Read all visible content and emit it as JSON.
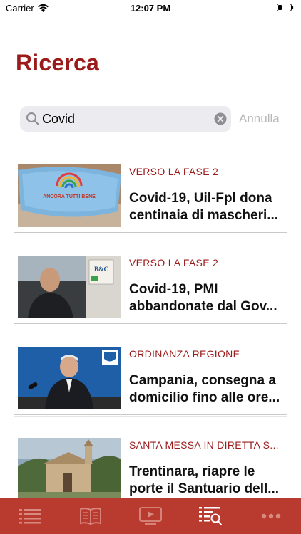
{
  "status_bar": {
    "carrier": "Carrier",
    "time": "12:07 PM"
  },
  "page": {
    "title": "Ricerca"
  },
  "search": {
    "value": "Covid",
    "cancel_label": "Annulla"
  },
  "articles": [
    {
      "category": "VERSO LA FASE 2",
      "title": "Covid-19, Uil-Fpl dona centinaia di mascheri...",
      "thumb_text": "ANCORA TUTTI BENE"
    },
    {
      "category": "VERSO LA FASE 2",
      "title": "Covid-19, PMI abbandonate dal Gov...",
      "thumb_text": "B&C"
    },
    {
      "category": "ORDINANZA REGIONE",
      "title": "Campania, consegna a domicilio fino alle ore...",
      "thumb_text": ""
    },
    {
      "category": "SANTA MESSA IN DIRETTA S...",
      "title": "Trentinara, riapre le porte il Santuario dell...",
      "thumb_text": ""
    }
  ],
  "tab_bar": {
    "tabs": [
      {
        "icon": "list-icon",
        "selected": false
      },
      {
        "icon": "book-icon",
        "selected": false
      },
      {
        "icon": "video-icon",
        "selected": false
      },
      {
        "icon": "search-list-icon",
        "selected": true
      },
      {
        "icon": "more-icon",
        "selected": false
      }
    ]
  },
  "colors": {
    "accent": "#9b1b1b",
    "tab_bar": "#b93a2e",
    "tab_icon": "#d98a80",
    "tab_icon_selected": "#ffffff"
  }
}
